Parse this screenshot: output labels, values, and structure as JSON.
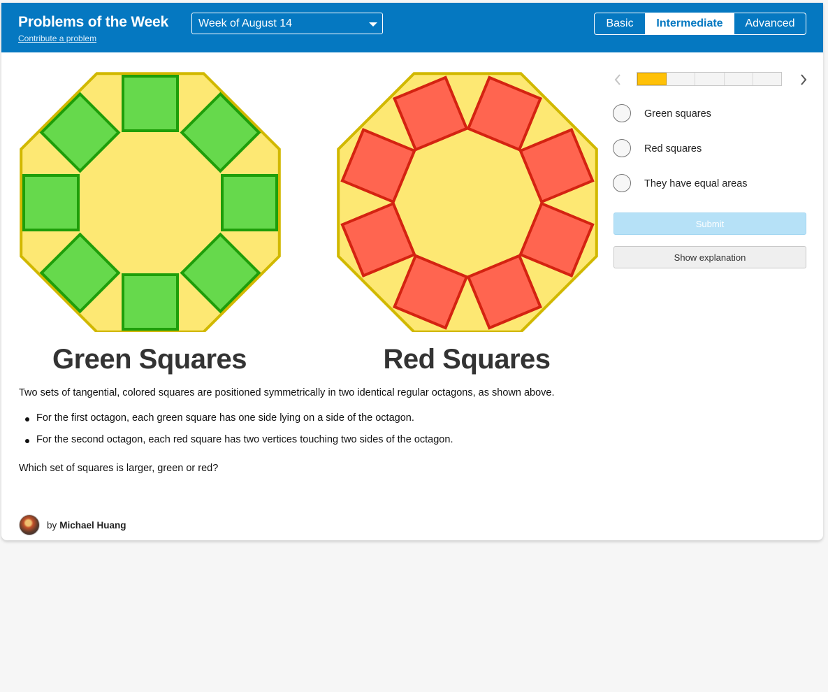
{
  "header": {
    "title": "Problems of the Week",
    "contribute_link": "Contribute a problem",
    "week_select": {
      "value": "Week of August 14"
    },
    "levels": [
      {
        "label": "Basic",
        "active": false
      },
      {
        "label": "Intermediate",
        "active": true
      },
      {
        "label": "Advanced",
        "active": false
      }
    ]
  },
  "figures": {
    "left_title": "Green Squares",
    "right_title": "Red Squares",
    "colors": {
      "octagon_fill": "#fde873",
      "octagon_stroke": "#d1b800",
      "green_fill": "#66d94c",
      "green_stroke": "#1e9e0a",
      "red_fill": "#ff6550",
      "red_stroke": "#d42311"
    }
  },
  "problem": {
    "intro": "Two sets of tangential, colored squares are positioned symmetrically in two identical regular octagons, as shown above.",
    "bullets": [
      "For the first octagon, each green square has one side lying on a side of the octagon.",
      "For the second octagon, each red square has two vertices touching two sides of the octagon."
    ],
    "question": "Which set of squares is larger, green or red?"
  },
  "author": {
    "by": "by",
    "name": "Michael Huang"
  },
  "progress": {
    "segments": 5,
    "current": 1
  },
  "answers": {
    "options": [
      "Green squares",
      "Red squares",
      "They have equal areas"
    ],
    "submit_label": "Submit",
    "explanation_label": "Show explanation"
  },
  "icons": {
    "prev": "chevron-left-icon",
    "next": "chevron-right-icon",
    "dropdown": "chevron-down-icon"
  }
}
